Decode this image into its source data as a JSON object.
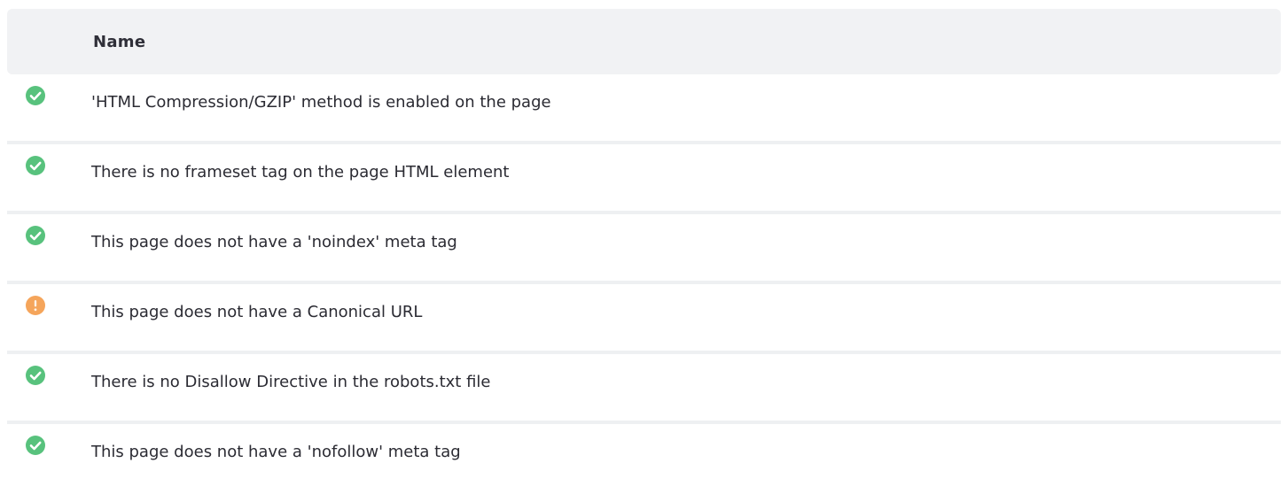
{
  "table": {
    "header": {
      "name": "Name"
    },
    "rows": [
      {
        "status": "pass",
        "icon": "check-circle-icon",
        "text": "'HTML Compression/GZIP' method is enabled on the page"
      },
      {
        "status": "pass",
        "icon": "check-circle-icon",
        "text": "There is no frameset tag on the page HTML element"
      },
      {
        "status": "pass",
        "icon": "check-circle-icon",
        "text": "This page does not have a 'noindex' meta tag"
      },
      {
        "status": "warning",
        "icon": "warning-circle-icon",
        "text": "This page does not have a Canonical URL"
      },
      {
        "status": "pass",
        "icon": "check-circle-icon",
        "text": "There is no Disallow Directive in the robots.txt file"
      },
      {
        "status": "pass",
        "icon": "check-circle-icon",
        "text": "This page does not have a 'nofollow' meta tag"
      }
    ]
  },
  "colors": {
    "pass": "#58c27d",
    "warning": "#f5a55b",
    "header_bg": "#f1f2f4",
    "row_divider": "#eef0f2"
  }
}
